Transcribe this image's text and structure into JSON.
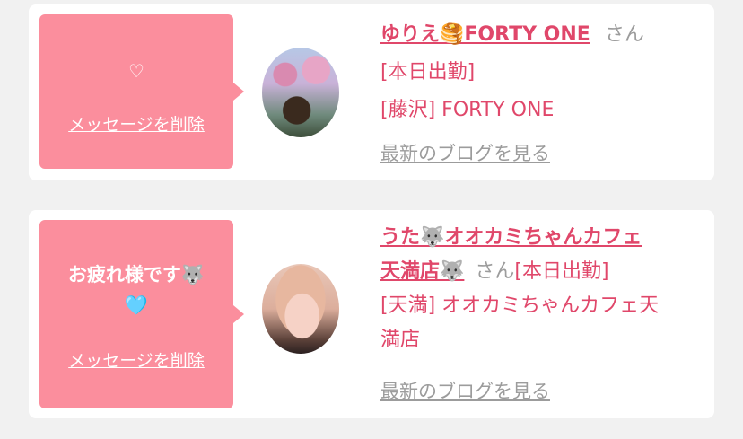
{
  "cards": [
    {
      "message": "♡",
      "delete_label": "メッセージを削除",
      "avatar_alt": "profile photo",
      "name": "ゆりえ🥞FORTY ONE",
      "honorific": "さん",
      "status": "[本日出勤]",
      "shop": "[藤沢] FORTY ONE",
      "blog_label": "最新のブログを見る"
    },
    {
      "message_line1": "お疲れ様です🐺",
      "message_line2": "🩵",
      "delete_label": "メッセージを削除",
      "name_line1": "うた🐺オオカミちゃんカフェ",
      "name_line2": "天満店🐺",
      "honorific": "さん",
      "status": "[本日出勤]",
      "shop_line1": "[天満] オオカミちゃんカフェ天",
      "shop_line2": "満店",
      "blog_label": "最新のブログを見る"
    }
  ],
  "colors": {
    "accent": "#e0476a",
    "bubble": "#fb8e9d",
    "muted": "#9c9c9c",
    "background": "#f1f1f1",
    "card": "#ffffff"
  }
}
